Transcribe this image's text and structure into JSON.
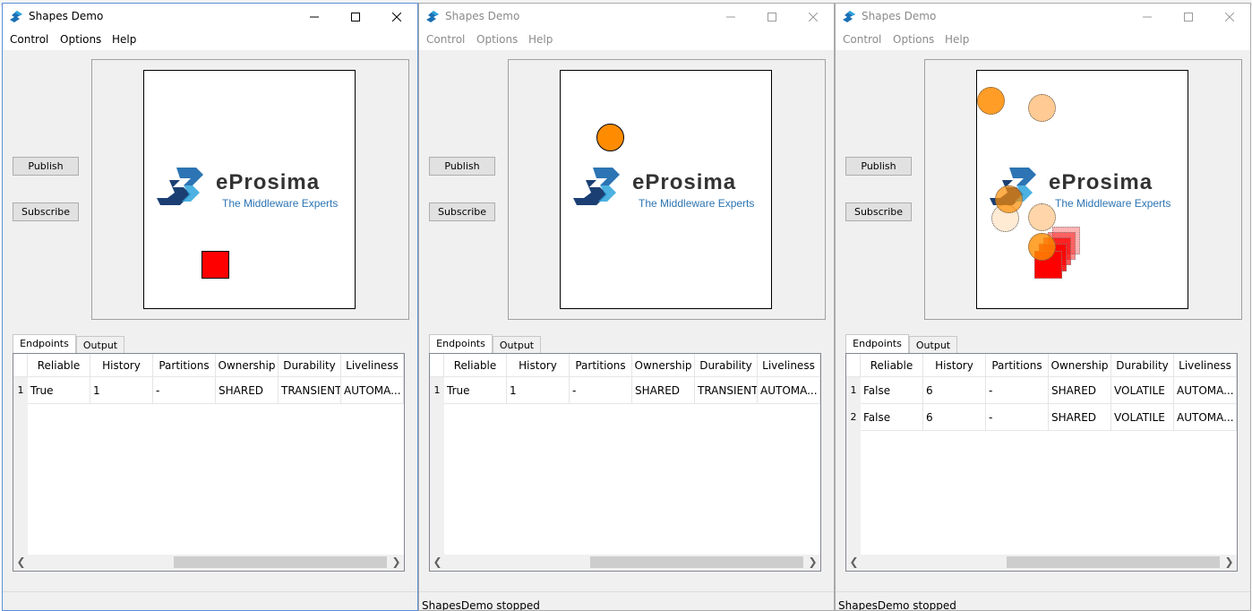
{
  "windows": [
    {
      "title": "Shapes Demo",
      "menu": [
        "Control",
        "Options",
        "Help"
      ],
      "buttons": {
        "publish": "Publish",
        "subscribe": "Subscribe"
      },
      "logo": {
        "word": "eProsima",
        "tagline": "The Middleware Experts"
      },
      "tabs": {
        "endpoints": "Endpoints",
        "output": "Output"
      },
      "columns": [
        "Reliable",
        "History",
        "Partitions",
        "Ownership",
        "Durability",
        "Liveliness"
      ],
      "rows": [
        {
          "num": "1",
          "cells": [
            "True",
            "1",
            "-",
            "SHARED",
            "TRANSIENT",
            "AUTOMA..."
          ]
        }
      ],
      "status": ""
    },
    {
      "title": "Shapes Demo",
      "menu": [
        "Control",
        "Options",
        "Help"
      ],
      "buttons": {
        "publish": "Publish",
        "subscribe": "Subscribe"
      },
      "logo": {
        "word": "eProsima",
        "tagline": "The Middleware Experts"
      },
      "tabs": {
        "endpoints": "Endpoints",
        "output": "Output"
      },
      "columns": [
        "Reliable",
        "History",
        "Partitions",
        "Ownership",
        "Durability",
        "Liveliness"
      ],
      "rows": [
        {
          "num": "1",
          "cells": [
            "True",
            "1",
            "-",
            "SHARED",
            "TRANSIENT",
            "AUTOMA..."
          ]
        }
      ],
      "status": "ShapesDemo stopped"
    },
    {
      "title": "Shapes Demo",
      "menu": [
        "Control",
        "Options",
        "Help"
      ],
      "buttons": {
        "publish": "Publish",
        "subscribe": "Subscribe"
      },
      "logo": {
        "word": "eProsima",
        "tagline": "The Middleware Experts"
      },
      "tabs": {
        "endpoints": "Endpoints",
        "output": "Output"
      },
      "columns": [
        "Reliable",
        "History",
        "Partitions",
        "Ownership",
        "Durability",
        "Liveliness"
      ],
      "rows": [
        {
          "num": "1",
          "cells": [
            "False",
            "6",
            "-",
            "SHARED",
            "VOLATILE",
            "AUTOMA..."
          ]
        },
        {
          "num": "2",
          "cells": [
            "False",
            "6",
            "-",
            "SHARED",
            "VOLATILE",
            "AUTOMA..."
          ]
        }
      ],
      "status": "ShapesDemo stopped"
    }
  ],
  "colors": {
    "square": "#ff0000",
    "circle": "#ff8c00",
    "logo_blue": "#2c74b3",
    "logo_navy": "#1b3f73"
  },
  "icons": [
    "shapes-app-icon",
    "minimize-icon",
    "maximize-icon",
    "close-icon",
    "scroll-left-icon",
    "scroll-right-icon"
  ]
}
